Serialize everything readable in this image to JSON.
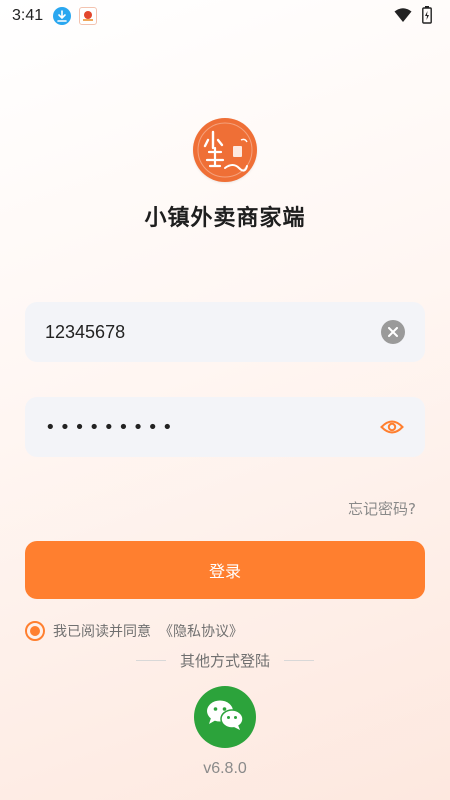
{
  "status_bar": {
    "time": "3:41",
    "icons": [
      "download-icon",
      "app-notification-icon",
      "wifi-icon",
      "battery-icon"
    ]
  },
  "app": {
    "title": "小镇外卖商家端",
    "logo_icon": "town-logo-icon",
    "logo_char": "小"
  },
  "login_form": {
    "phone_value": "12345678",
    "password_mask": "•••••••••",
    "forgot_label": "忘记密码?",
    "login_label": "登录",
    "agree_text": "我已阅读并同意",
    "privacy_link": "《隐私协议》",
    "agree_checked": true
  },
  "other_login": {
    "label": "其他方式登陆",
    "wechat_icon": "wechat-icon"
  },
  "footer": {
    "version": "v6.8.0"
  },
  "colors": {
    "accent": "#ff7f2f",
    "logo_bg": "#ef6f36",
    "wechat_green": "#2ca33b",
    "field_bg": "#f3f4f8"
  }
}
